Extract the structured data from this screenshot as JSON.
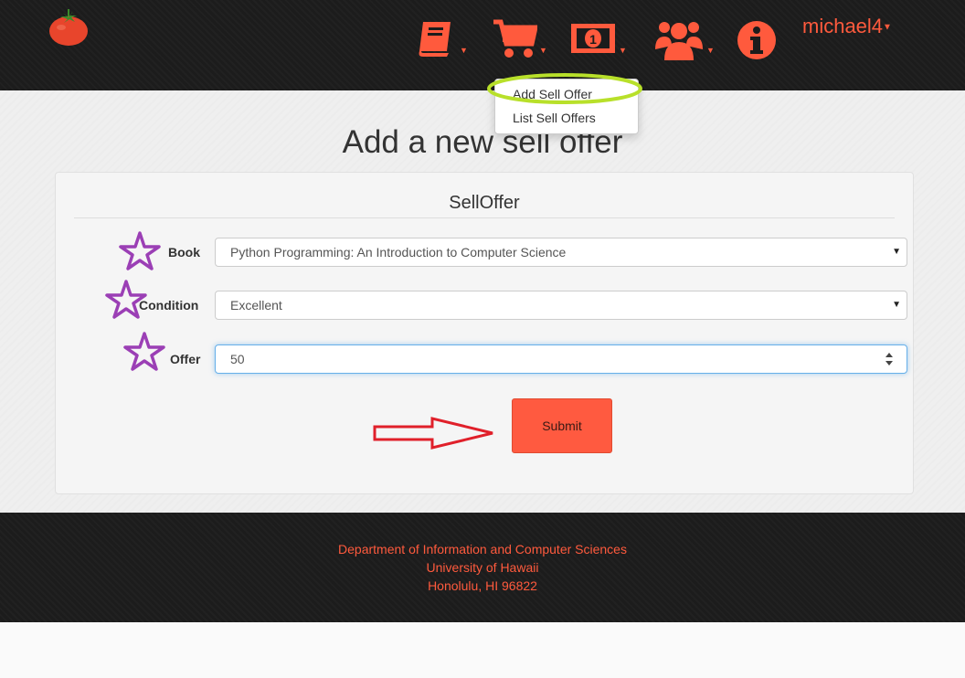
{
  "header": {
    "username": "michael4",
    "nav": [
      {
        "name": "books-menu",
        "icon": "book-icon"
      },
      {
        "name": "buy-menu",
        "icon": "cart-icon"
      },
      {
        "name": "sell-menu",
        "icon": "money-icon"
      },
      {
        "name": "users-menu",
        "icon": "users-icon"
      },
      {
        "name": "info-menu",
        "icon": "info-icon"
      }
    ]
  },
  "dropdown": {
    "items": [
      "Add Sell Offer",
      "List Sell Offers"
    ]
  },
  "page": {
    "title": "Add a new sell offer"
  },
  "form": {
    "title": "SellOffer",
    "book_label": "Book",
    "book_value": "Python Programming: An Introduction to Computer Science",
    "condition_label": "Condition",
    "condition_value": "Excellent",
    "offer_label": "Offer",
    "offer_value": "50",
    "submit_label": "Submit"
  },
  "footer": {
    "line1": "Department of Information and Computer Sciences",
    "line2": "University of Hawaii",
    "line3": "Honolulu, HI 96822"
  },
  "colors": {
    "accent": "#ff5a3d",
    "header_bg": "#1c1c1c",
    "annotation_star": "#9b3fb5",
    "annotation_ellipse": "#b8e02a",
    "annotation_arrow": "#e0202a"
  }
}
